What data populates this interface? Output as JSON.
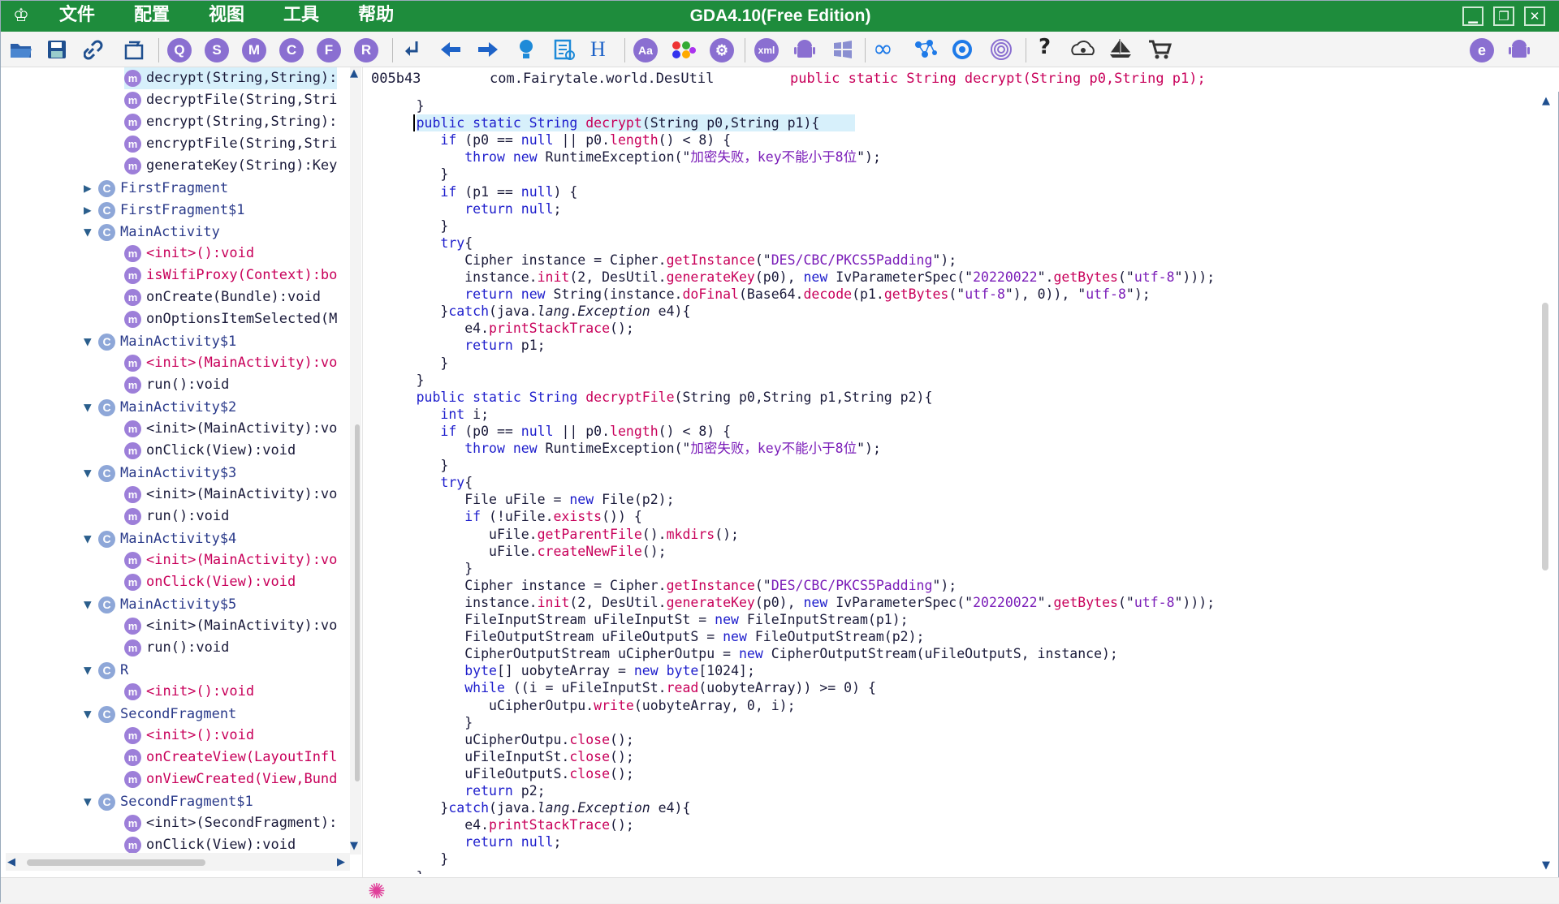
{
  "window": {
    "title": "GDA4.10(Free Edition)",
    "menu": [
      "文件",
      "配置",
      "视图",
      "工具",
      "帮助"
    ],
    "minimize": "▁",
    "maximize": "❐",
    "close": "✕"
  },
  "toolbar": {
    "buttons": [
      "open-folder-icon",
      "save-icon",
      "link-icon",
      "refresh-icon",
      "search-q-icon",
      "search-s-icon",
      "search-m-icon",
      "search-c-icon",
      "search-f-icon",
      "search-r-icon",
      "goto-icon",
      "back-arrow-icon",
      "forward-arrow-icon",
      "bulb-icon",
      "scan-icon",
      "hex-icon",
      "string-aa-icon",
      "color-dots-icon",
      "gear-icon",
      "xml-icon",
      "android-icon",
      "windows-icon",
      "infinity-icon",
      "nodes-icon",
      "circle-icon",
      "fingerprint-icon",
      "help-icon",
      "eye-cloud-icon",
      "ship-icon",
      "cart-icon",
      "e-icon",
      "android-right-icon"
    ],
    "labels": {
      "q": "Q",
      "s": "S",
      "m": "M",
      "c": "C",
      "f": "F",
      "r": "R",
      "aa": "Aa",
      "xml": "xml",
      "hex": "H",
      "help": "?"
    }
  },
  "tree": [
    {
      "kind": "m",
      "style": "mt",
      "text": "decrypt(String,String):"
    },
    {
      "kind": "m",
      "style": "mt",
      "text": "decryptFile(String,Stri"
    },
    {
      "kind": "m",
      "style": "mt",
      "text": "encrypt(String,String):"
    },
    {
      "kind": "m",
      "style": "mt",
      "text": "encryptFile(String,Stri"
    },
    {
      "kind": "m",
      "style": "mt",
      "text": "generateKey(String):Key"
    },
    {
      "kind": "c",
      "tw": "▶",
      "text": "FirstFragment"
    },
    {
      "kind": "c",
      "tw": "▶",
      "text": "FirstFragment$1"
    },
    {
      "kind": "c",
      "tw": "▼",
      "text": "MainActivity"
    },
    {
      "kind": "m",
      "style": "mr",
      "text": "<init>():void"
    },
    {
      "kind": "m",
      "style": "mr",
      "text": "isWifiProxy(Context):bo"
    },
    {
      "kind": "m",
      "style": "mt",
      "text": "onCreate(Bundle):void"
    },
    {
      "kind": "m",
      "style": "mt",
      "text": "onOptionsItemSelected(M"
    },
    {
      "kind": "c",
      "tw": "▼",
      "text": "MainActivity$1"
    },
    {
      "kind": "m",
      "style": "mr",
      "text": "<init>(MainActivity):vo"
    },
    {
      "kind": "m",
      "style": "mt",
      "text": "run():void"
    },
    {
      "kind": "c",
      "tw": "▼",
      "text": "MainActivity$2"
    },
    {
      "kind": "m",
      "style": "mt",
      "text": "<init>(MainActivity):vo"
    },
    {
      "kind": "m",
      "style": "mt",
      "text": "onClick(View):void"
    },
    {
      "kind": "c",
      "tw": "▼",
      "text": "MainActivity$3"
    },
    {
      "kind": "m",
      "style": "mt",
      "text": "<init>(MainActivity):vo"
    },
    {
      "kind": "m",
      "style": "mt",
      "text": "run():void"
    },
    {
      "kind": "c",
      "tw": "▼",
      "text": "MainActivity$4"
    },
    {
      "kind": "m",
      "style": "mr",
      "text": "<init>(MainActivity):vo"
    },
    {
      "kind": "m",
      "style": "mr",
      "text": "onClick(View):void"
    },
    {
      "kind": "c",
      "tw": "▼",
      "text": "MainActivity$5"
    },
    {
      "kind": "m",
      "style": "mt",
      "text": "<init>(MainActivity):vo"
    },
    {
      "kind": "m",
      "style": "mt",
      "text": "run():void"
    },
    {
      "kind": "c",
      "tw": "▼",
      "text": "R"
    },
    {
      "kind": "m",
      "style": "mr",
      "text": "<init>():void"
    },
    {
      "kind": "c",
      "tw": "▼",
      "text": "SecondFragment"
    },
    {
      "kind": "m",
      "style": "mr",
      "text": "<init>():void"
    },
    {
      "kind": "m",
      "style": "mr",
      "text": "onCreateView(LayoutInfl"
    },
    {
      "kind": "m",
      "style": "mr",
      "text": "onViewCreated(View,Bund"
    },
    {
      "kind": "c",
      "tw": "▼",
      "text": "SecondFragment$1"
    },
    {
      "kind": "m",
      "style": "mt",
      "text": "<init>(SecondFragment):"
    },
    {
      "kind": "m",
      "style": "mt",
      "text": "onClick(View):void"
    }
  ],
  "tree_badges": {
    "class": "C",
    "method": "m"
  },
  "info": {
    "address": "005b43",
    "class": "com.Fairytale.world.DesUtil",
    "signature": "public static String decrypt(String p0,String p1);"
  },
  "code": [
    "      }",
    "      [k]public static String[/] [f]decrypt[/](String p0,String p1){",
    "         [k]if[/] (p0 == [k]null[/] || p0.[f]length[/]() < 8) {",
    "            [k]throw new[/] RuntimeException(\"[s]加密失败，key不能小于8位[/]\");",
    "         }",
    "         [k]if[/] (p1 == [k]null[/]) {",
    "            [k]return null[/];",
    "         }",
    "         [k]try[/]{",
    "            Cipher instance = Cipher.[f]getInstance[/](\"[s]DES/CBC/PKCS5Padding[/]\");",
    "            instance.[f]init[/](2, DesUtil.[f]generateKey[/](p0), [k]new[/] IvParameterSpec(\"[s]20220022[/]\".[f]getBytes[/](\"[s]utf-8[/]\")));",
    "            [k]return new[/] String(instance.[f]doFinal[/](Base64.[f]decode[/](p1.[f]getBytes[/](\"[s]utf-8[/]\"), 0)), \"[s]utf-8[/]\");",
    "         }[k]catch[/](java.[i]lang[/].[i]Exception[/] e4){",
    "            e4.[f]printStackTrace[/]();",
    "            [k]return[/] p1;",
    "         }",
    "      }",
    "      [k]public static String[/] [f]decryptFile[/](String p0,String p1,String p2){",
    "         [k]int[/] i;",
    "         [k]if[/] (p0 == [k]null[/] || p0.[f]length[/]() < 8) {",
    "            [k]throw new[/] RuntimeException(\"[s]加密失败，key不能小于8位[/]\");",
    "         }",
    "         [k]try[/]{",
    "            File uFile = [k]new[/] File(p2);",
    "            [k]if[/] (!uFile.[f]exists[/]()) {",
    "               uFile.[f]getParentFile[/]().[f]mkdirs[/]();",
    "               uFile.[f]createNewFile[/]();",
    "            }",
    "            Cipher instance = Cipher.[f]getInstance[/](\"[s]DES/CBC/PKCS5Padding[/]\");",
    "            instance.[f]init[/](2, DesUtil.[f]generateKey[/](p0), [k]new[/] IvParameterSpec(\"[s]20220022[/]\".[f]getBytes[/](\"[s]utf-8[/]\")));",
    "            FileInputStream uFileInputSt = [k]new[/] FileInputStream(p1);",
    "            FileOutputStream uFileOutputS = [k]new[/] FileOutputStream(p2);",
    "            CipherOutputStream uCipherOutpu = [k]new[/] CipherOutputStream(uFileOutputS, instance);",
    "            [k]byte[/][] uobyteArray = [k]new byte[/][1024];",
    "            [k]while[/] ((i = uFileInputSt.[f]read[/](uobyteArray)) >= 0) {",
    "               uCipherOutpu.[f]write[/](uobyteArray, 0, i);",
    "            }",
    "            uCipherOutpu.[f]close[/]();",
    "            uFileInputSt.[f]close[/]();",
    "            uFileOutputS.[f]close[/]();",
    "            [k]return[/] p2;",
    "         }[k]catch[/](java.[i]lang[/].[i]Exception[/] e4){",
    "            e4.[f]printStackTrace[/]();",
    "            [k]return null[/];",
    "         }",
    "      }"
  ],
  "colors": {
    "titlebar": "#1e8c3c",
    "keyword": "#1d1dcc",
    "function": "#c8005a",
    "string": "#7a1cb8",
    "highlight": "#d7f0fb"
  },
  "status": {
    "icon": "spinner-icon",
    "glyph": "✺"
  }
}
